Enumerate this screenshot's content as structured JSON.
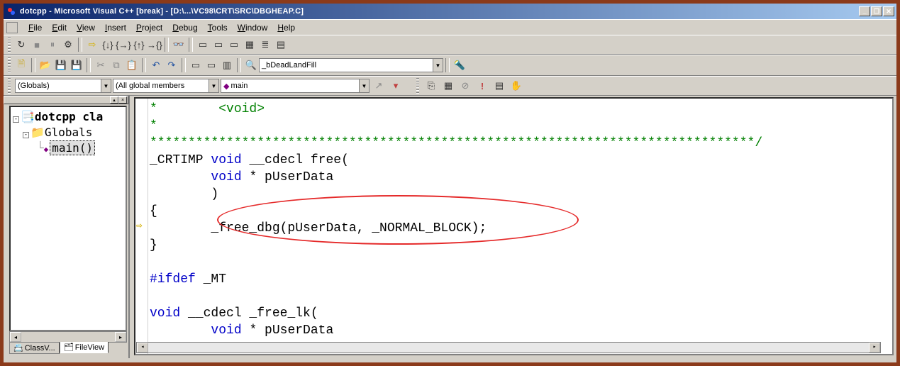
{
  "title": "dotcpp - Microsoft Visual C++ [break] - [D:\\...\\VC98\\CRT\\SRC\\DBGHEAP.C]",
  "menu": [
    "File",
    "Edit",
    "View",
    "Insert",
    "Project",
    "Debug",
    "Tools",
    "Window",
    "Help"
  ],
  "toolbar2": {
    "find_text": "_bDeadLandFill"
  },
  "combos": {
    "context": "(Globals)",
    "members": "(All global members",
    "func": "main",
    "func_prefix": "◆"
  },
  "tree": {
    "root": "dotcpp cla",
    "child1": "Globals",
    "child2": "main()"
  },
  "pane_tabs": {
    "classview": "ClassV...",
    "fileview": "FileView"
  },
  "code": {
    "l1_a": "*        ",
    "l1_b": "<void>",
    "l2": "*",
    "l3": "*******************************************************************************/",
    "l4_a": "_CRTIMP ",
    "l4_b": "void",
    "l4_c": " __cdecl free(",
    "l5_a": "        ",
    "l5_b": "void",
    "l5_c": " * pUserData",
    "l6": "        )",
    "l7": "{",
    "l8": "        _free_dbg(pUserData, _NORMAL_BLOCK);",
    "l9": "}",
    "l10": "",
    "l11_a": "#ifdef",
    "l11_b": " _MT",
    "l12": "",
    "l13_a": "void",
    "l13_b": " __cdecl _free_lk(",
    "l14_a": "        ",
    "l14_b": "void",
    "l14_c": " * pUserData"
  },
  "dbg_icons": {
    "restart": "↻",
    "stop": "■",
    "break": "⏸",
    "next": "{}",
    "into": "↘",
    "over": "⤵",
    "out": "↗",
    "run": "▶",
    "watch": "👁",
    "qw": "⬚",
    "mem": "▦",
    "reg": "☰",
    "stack": "≡",
    "disasm": "⋯"
  }
}
